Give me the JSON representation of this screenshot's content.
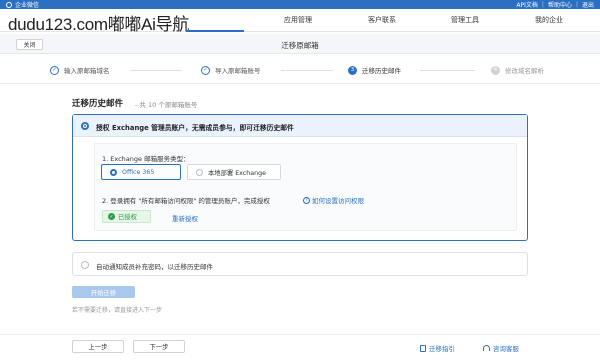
{
  "brand": {
    "app_name": "企业微信",
    "links": [
      "API文档",
      "帮助中心",
      "退出"
    ]
  },
  "watermark": "dudu123.com嘟嘟Ai导航",
  "nav": {
    "items": [
      "应用管理",
      "客户联系",
      "管理工具",
      "我的企业"
    ]
  },
  "title_bar": {
    "close_label": "关闭",
    "title": "迁移原邮箱"
  },
  "steps": [
    {
      "num": "✓",
      "label": "输入原邮箱域名",
      "state": "done"
    },
    {
      "num": "✓",
      "label": "导入原邮箱账号",
      "state": "done"
    },
    {
      "num": "3",
      "label": "迁移历史邮件",
      "state": "current"
    },
    {
      "num": "4",
      "label": "修改域名解析",
      "state": "todo"
    }
  ],
  "section": {
    "heading": "迁移历史邮件",
    "sub": "- 共 10 个原邮箱账号"
  },
  "option1": {
    "header": "授权 Exchange 管理员账户，无需成员参与，即可迁移历史邮件",
    "q1": "1. Exchange 邮箱服务类型：",
    "choices": [
      "Office 365",
      "本地部署 Exchange"
    ],
    "selected": "Office 365",
    "q2": "2. 登录拥有 \"所有邮箱访问权限\" 的管理员账户，完成授权",
    "help_link": "如何设置访问权限",
    "authorized": "已授权",
    "reauth": "重新授权"
  },
  "option2": {
    "label": "自动通知成员补充密码，以迁移历史邮件"
  },
  "start_button": "开始迁移",
  "hint": "若不需要迁移，请直接进入下一步",
  "footer": {
    "prev": "上一步",
    "next": "下一步",
    "guide": "迁移指引",
    "consult": "咨询客服"
  },
  "colors": {
    "accent": "#2b6fc2",
    "success": "#2e9b45",
    "disabled_button": "#a9c8ee"
  }
}
